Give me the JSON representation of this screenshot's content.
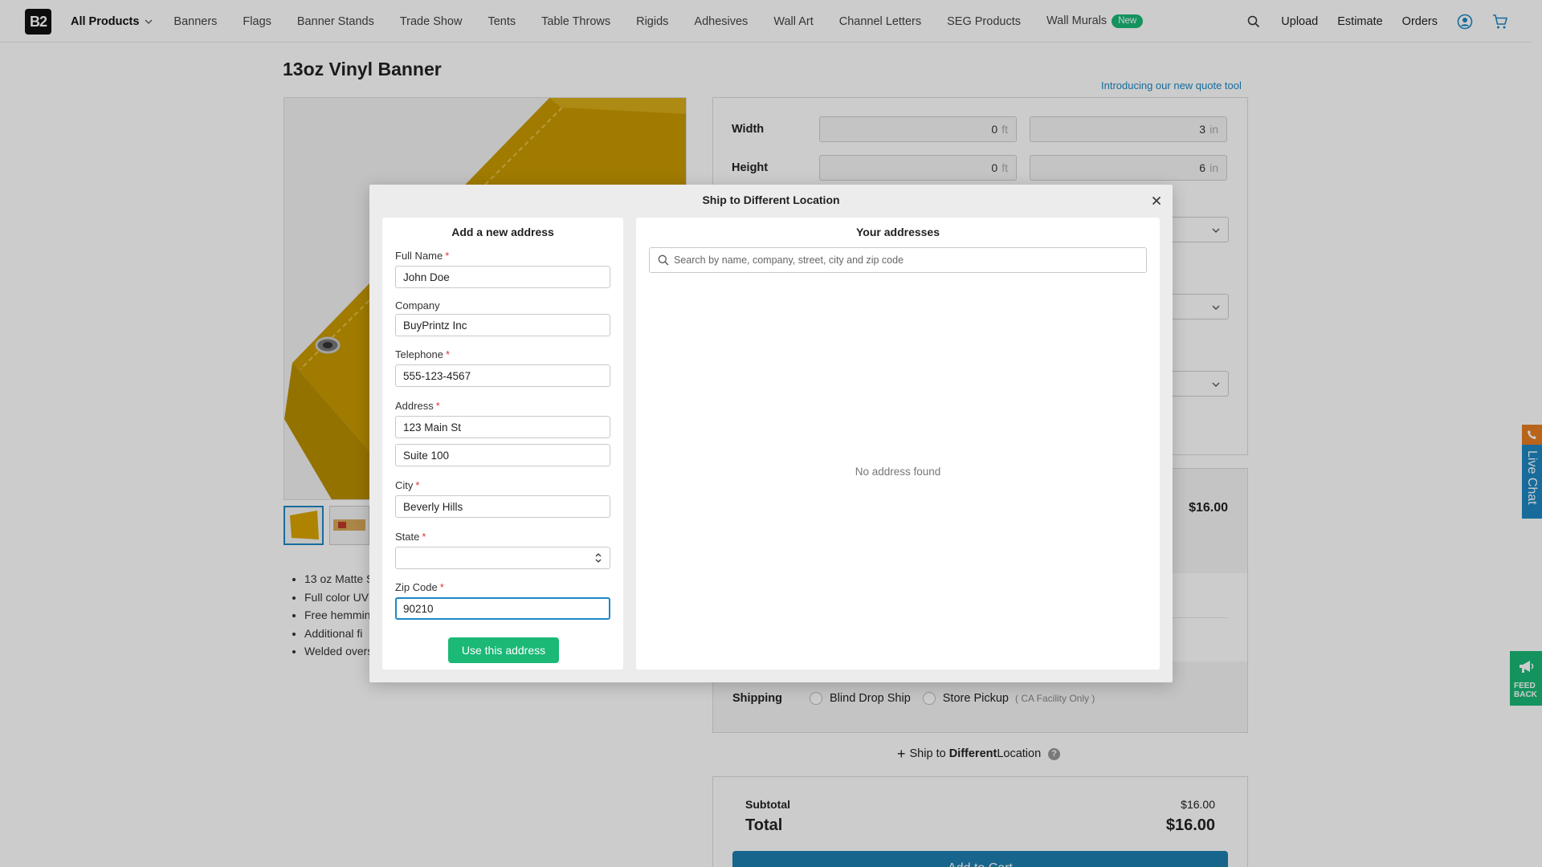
{
  "header": {
    "logo": "B2",
    "nav": [
      {
        "label": "All Products"
      },
      {
        "label": "Banners"
      },
      {
        "label": "Flags"
      },
      {
        "label": "Banner Stands"
      },
      {
        "label": "Trade Show"
      },
      {
        "label": "Tents"
      },
      {
        "label": "Table Throws"
      },
      {
        "label": "Rigids"
      },
      {
        "label": "Adhesives"
      },
      {
        "label": "Wall Art"
      },
      {
        "label": "Channel Letters"
      },
      {
        "label": "SEG Products"
      },
      {
        "label": "Wall Murals",
        "badge": "New"
      }
    ],
    "right": {
      "upload": "Upload",
      "estimate": "Estimate",
      "orders": "Orders"
    }
  },
  "product": {
    "title": "13oz Vinyl Banner",
    "quote_link": "Introducing our new quote tool",
    "bullets": [
      "13 oz Matte S",
      "Full color UV",
      "Free hemmin",
      "Additional fi",
      "Welded overs"
    ]
  },
  "config": {
    "width": {
      "label": "Width",
      "ft": "0",
      "in": "3"
    },
    "height": {
      "label": "Height",
      "ft": "0",
      "in": "6"
    },
    "units": {
      "ft": "ft",
      "in": "in"
    },
    "price": "$16.00"
  },
  "shipping": {
    "label": "Shipping",
    "options": [
      "Blind Drop Ship",
      "Store Pickup"
    ],
    "pickup_note": "( CA Facility Only )",
    "diff_prefix": "Ship to ",
    "diff_bold": "Different",
    "diff_suffix": " Location",
    "help": "?"
  },
  "totals": {
    "subtotal_label": "Subtotal",
    "subtotal": "$16.00",
    "total_label": "Total",
    "total": "$16.00",
    "cart_button": "Add to Cart"
  },
  "side": {
    "live_chat": "Live Chat",
    "feedback_1": "FEED",
    "feedback_2": "BACK"
  },
  "modal": {
    "title": "Ship to Different Location",
    "form": {
      "title": "Add a new address",
      "full_name": {
        "label": "Full Name",
        "value": "John Doe"
      },
      "company": {
        "label": "Company",
        "value": "BuyPrintz Inc"
      },
      "telephone": {
        "label": "Telephone",
        "value": "555-123-4567"
      },
      "address": {
        "label": "Address",
        "line1": "123 Main St",
        "line2": "Suite 100"
      },
      "city": {
        "label": "City",
        "value": "Beverly Hills"
      },
      "state": {
        "label": "State",
        "value": ""
      },
      "zip": {
        "label": "Zip Code",
        "value": "90210"
      },
      "submit": "Use this address"
    },
    "list": {
      "title": "Your addresses",
      "search_placeholder": "Search by name, company, street, city and zip code",
      "empty": "No address found"
    }
  }
}
